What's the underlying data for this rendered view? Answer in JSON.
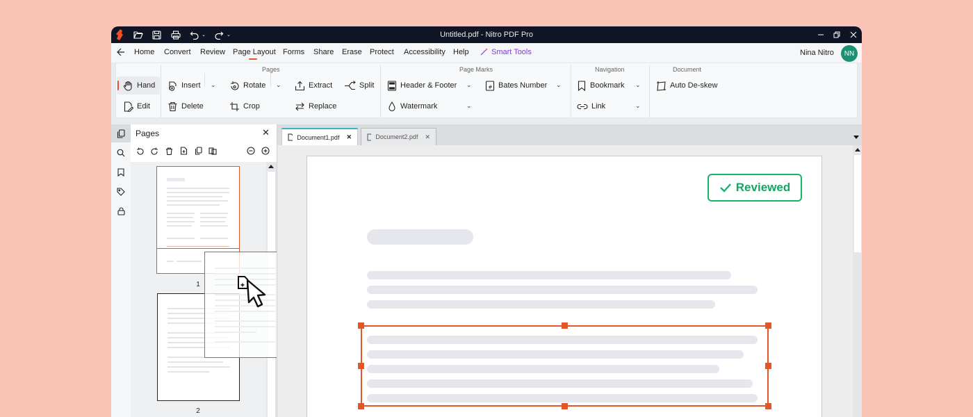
{
  "window": {
    "title": "Untitled.pdf - Nitro PDF Pro"
  },
  "menu": {
    "items": [
      "Home",
      "Convert",
      "Review",
      "Page Layout",
      "Forms",
      "Share",
      "Erase",
      "Protect",
      "Accessibility",
      "Help"
    ],
    "smart_tools": "Smart Tools",
    "active": "Page Layout"
  },
  "user": {
    "name": "Nina Nitro",
    "initials": "NN"
  },
  "ribbon": {
    "groups": {
      "pages": "Pages",
      "page_marks": "Page Marks",
      "navigation": "Navigation",
      "document": "Document"
    },
    "buttons": {
      "hand": "Hand",
      "edit": "Edit",
      "insert": "Insert",
      "delete": "Delete",
      "rotate": "Rotate",
      "crop": "Crop",
      "extract": "Extract",
      "split": "Split",
      "replace": "Replace",
      "header_footer": "Header & Footer",
      "watermark": "Watermark",
      "bates_number": "Bates Number",
      "bookmark": "Bookmark",
      "link": "Link",
      "auto_deskew": "Auto De-skew"
    }
  },
  "pages_panel": {
    "title": "Pages",
    "close": "✕",
    "page_numbers": [
      "1",
      "2"
    ]
  },
  "tabs": [
    {
      "label": "Document1.pdf",
      "close": "✕"
    },
    {
      "label": "Document2.pdf",
      "close": "✕"
    }
  ],
  "document": {
    "stamp": "Reviewed"
  },
  "colors": {
    "accent": "#e2562a",
    "reviewed": "#16b36a",
    "avatar": "#1c8f74",
    "titlebar": "#0f1524",
    "smart_tools": "#7b3fd1"
  }
}
